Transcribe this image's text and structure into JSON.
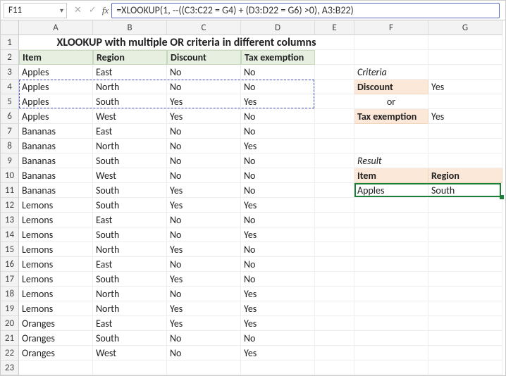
{
  "nameBox": "F11",
  "formula": "=XLOOKUP(1, --((C3:C22 = G4) + (D3:D22 = G6) >0), A3:B22)",
  "title": "XLOOKUP with multiple OR criteria in different columns",
  "colHeaders": [
    "A",
    "B",
    "C",
    "D",
    "E",
    "F",
    "G"
  ],
  "rowCount": 23,
  "tableHeaders": [
    "Item",
    "Region",
    "Discount",
    "Tax exemption"
  ],
  "rows": [
    [
      "Apples",
      "East",
      "No",
      "No"
    ],
    [
      "Apples",
      "North",
      "No",
      "No"
    ],
    [
      "Apples",
      "South",
      "Yes",
      "Yes"
    ],
    [
      "Apples",
      "West",
      "Yes",
      "No"
    ],
    [
      "Bananas",
      "East",
      "No",
      "No"
    ],
    [
      "Bananas",
      "North",
      "No",
      "Yes"
    ],
    [
      "Bananas",
      "South",
      "No",
      "No"
    ],
    [
      "Bananas",
      "West",
      "No",
      "No"
    ],
    [
      "Bananas",
      "South",
      "Yes",
      "No"
    ],
    [
      "Lemons",
      "South",
      "Yes",
      "Yes"
    ],
    [
      "Lemons",
      "East",
      "No",
      "No"
    ],
    [
      "Lemons",
      "South",
      "No",
      "Yes"
    ],
    [
      "Lemons",
      "North",
      "Yes",
      "No"
    ],
    [
      "Lemons",
      "East",
      "No",
      "No"
    ],
    [
      "Lemons",
      "South",
      "Yes",
      "No"
    ],
    [
      "Lemons",
      "North",
      "No",
      "Yes"
    ],
    [
      "Lemons",
      "North",
      "Yes",
      "Yes"
    ],
    [
      "Oranges",
      "East",
      "Yes",
      "Yes"
    ],
    [
      "Oranges",
      "South",
      "No",
      "No"
    ],
    [
      "Oranges",
      "West",
      "No",
      "Yes"
    ]
  ],
  "criteria": {
    "label": "Criteria",
    "discountLabel": "Discount",
    "discountValue": "Yes",
    "or": "or",
    "taxLabel": "Tax exemption",
    "taxValue": "Yes"
  },
  "result": {
    "label": "Result",
    "itemHeader": "Item",
    "regionHeader": "Region",
    "item": "Apples",
    "region": "South"
  }
}
